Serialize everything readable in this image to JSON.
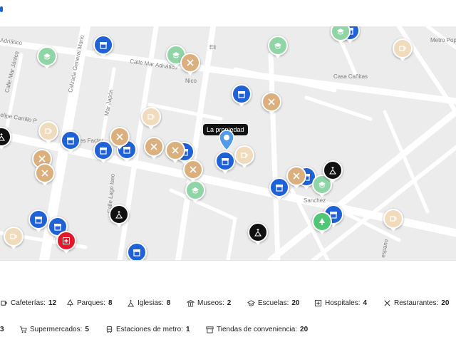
{
  "map": {
    "property_label": "La propiedad",
    "streets": [
      {
        "id": "mar-adriatico",
        "text": "Calle Mar Adriático"
      },
      {
        "id": "adriatico-left",
        "text": "Adriático"
      },
      {
        "id": "mar-jonico",
        "text": "Calle Mar Jónico"
      },
      {
        "id": "general-mario",
        "text": "Calzada General Mario"
      },
      {
        "id": "mar-japon",
        "text": "Mar Japón"
      },
      {
        "id": "felipe-carrillo",
        "text": "elipe Carrillo P"
      },
      {
        "id": "lago-iseo",
        "text": "Calle Lago Iseo"
      },
      {
        "id": "factor",
        "text": "es Factor"
      },
      {
        "id": "eli",
        "text": "Eli"
      },
      {
        "id": "nico",
        "text": "Nico"
      },
      {
        "id": "metro-pop",
        "text": "Metro Pop"
      },
      {
        "id": "casa-canitas",
        "text": "Casa Cañitas"
      },
      {
        "id": "sanchez",
        "text": "Sanchez"
      },
      {
        "id": "espano",
        "text": "espano"
      }
    ],
    "colors": {
      "school": "#8fd5a6",
      "restaurant": "#dcb07e",
      "cafe": "#f1dbbd",
      "convenience": "#1f62d8",
      "church": "#111111",
      "hospital": "#e3192b",
      "park": "#4fc777",
      "property": "#4f9be9"
    }
  },
  "legend": [
    {
      "id": "cafeterias",
      "label": "Cafeterías:",
      "count": "12",
      "icon": "cup-icon"
    },
    {
      "id": "parques",
      "label": "Parques:",
      "count": "8",
      "icon": "tree-icon"
    },
    {
      "id": "iglesias",
      "label": "Iglesias:",
      "count": "8",
      "icon": "church-icon"
    },
    {
      "id": "museos",
      "label": "Museos:",
      "count": "2",
      "icon": "museum-icon"
    },
    {
      "id": "escuelas",
      "label": "Escuelas:",
      "count": "20",
      "icon": "school-icon"
    },
    {
      "id": "hospitales",
      "label": "Hospitales:",
      "count": "4",
      "icon": "hospital-icon"
    },
    {
      "id": "restaurantes",
      "label": "Restaurantes:",
      "count": "20",
      "icon": "utensils-icon"
    },
    {
      "id": "leading",
      "label": "",
      "count": "3",
      "icon": ""
    },
    {
      "id": "supermercados",
      "label": "Supermercados:",
      "count": "5",
      "icon": "cart-icon"
    },
    {
      "id": "metro",
      "label": "Estaciones de metro:",
      "count": "1",
      "icon": "metro-icon"
    },
    {
      "id": "conveniencia",
      "label": "Tiendas de conveniencia:",
      "count": "20",
      "icon": "store-icon"
    }
  ]
}
